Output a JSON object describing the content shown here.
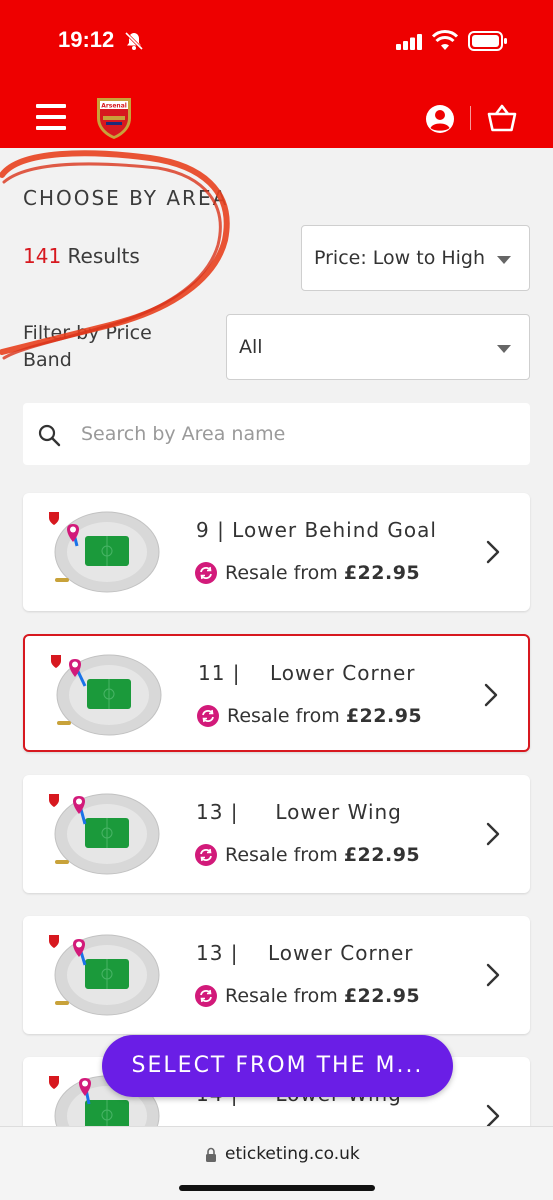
{
  "status": {
    "time": "19:12"
  },
  "header": {
    "menu": "menu-icon",
    "logo": "arsenal-crest",
    "account": "user-icon",
    "basket": "basket-icon",
    "logo_text": "Arsenal"
  },
  "filters": {
    "heading": "CHOOSE BY AREA",
    "results_count": "141",
    "results_label": "Results",
    "sort_value": "Price: Low to High",
    "price_band_label": "Filter by Price Band",
    "price_band_value": "All",
    "search_placeholder": "Search by Area name"
  },
  "areas": [
    {
      "title": "9 | Lower Behind Goal",
      "resale_label": "Resale from",
      "price": "£22.95",
      "selected": false
    },
    {
      "title": "11 |    Lower Corner",
      "resale_label": "Resale from",
      "price": "£22.95",
      "selected": true
    },
    {
      "title": "13 |     Lower Wing",
      "resale_label": "Resale from",
      "price": "£22.95",
      "selected": false
    },
    {
      "title": "13 |    Lower Corner",
      "resale_label": "Resale from",
      "price": "£22.95",
      "selected": false
    },
    {
      "title": "14 |     Lower Wing",
      "resale_label": "",
      "price": "",
      "selected": false
    }
  ],
  "fab": {
    "label": "SELECT FROM THE M..."
  },
  "browser": {
    "url": "eticketing.co.uk"
  },
  "colors": {
    "brand_red": "#ee0000",
    "accent_purple": "#6a1ee6",
    "resale_magenta": "#d21a7a",
    "pitch_green": "#1b9a3b"
  }
}
